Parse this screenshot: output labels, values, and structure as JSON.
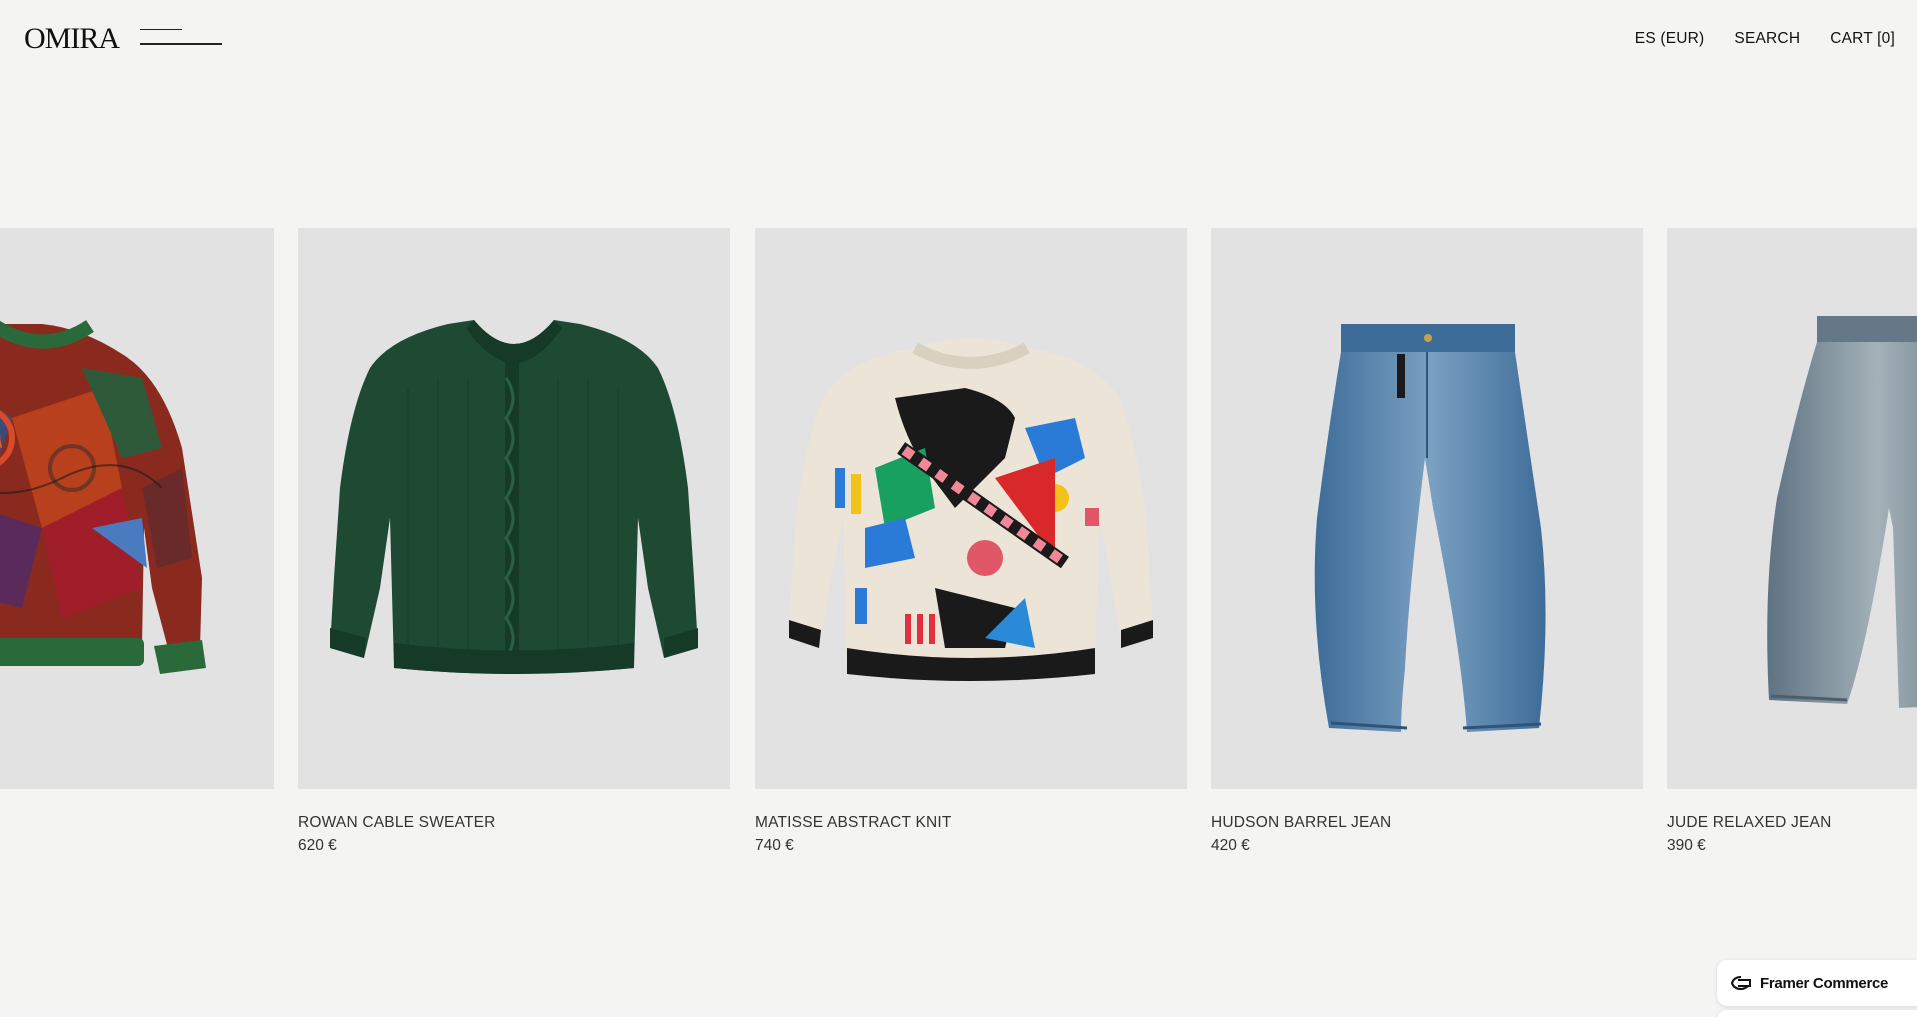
{
  "header": {
    "logo": "OMIRA",
    "menu_icon": "menu-icon",
    "locale": "ES (EUR)",
    "search": "SEARCH",
    "cart": "CART [0]"
  },
  "products": [
    {
      "name": "",
      "price": "",
      "image": "multicolor-patchwork-sweater"
    },
    {
      "name": "ROWAN CABLE SWEATER",
      "price": "620 €",
      "image": "green-cable-sweater"
    },
    {
      "name": "MATISSE ABSTRACT KNIT",
      "price": "740 €",
      "image": "abstract-knit-sweater"
    },
    {
      "name": "HUDSON BARREL JEAN",
      "price": "420 €",
      "image": "blue-barrel-jean"
    },
    {
      "name": "JUDE RELAXED JEAN",
      "price": "390 €",
      "image": "grey-relaxed-jean"
    }
  ],
  "badge": {
    "label": "Framer Commerce",
    "icon": "framer-commerce-icon"
  },
  "colors": {
    "background": "#f4f4f3",
    "image_bg": "#e2e2e3",
    "green_sweater": "#1e4a34",
    "denim_blue": "#4f7fa8",
    "denim_grey": "#7b8c98"
  }
}
